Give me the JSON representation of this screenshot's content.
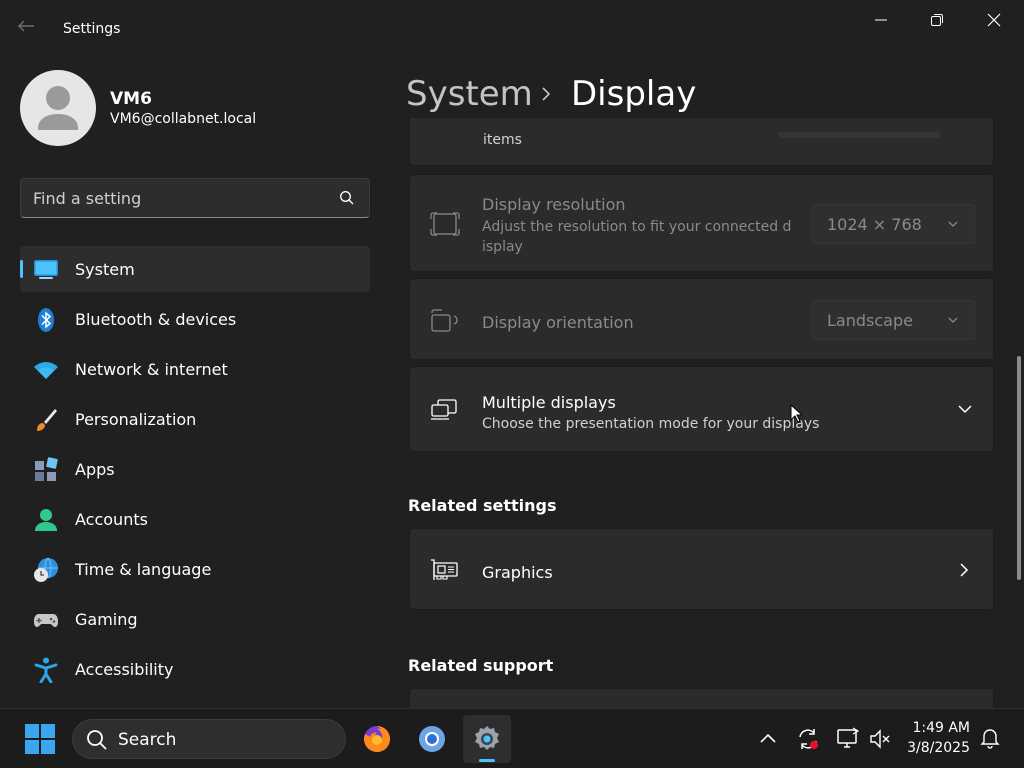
{
  "window": {
    "title": "Settings"
  },
  "profile": {
    "name": "VM6",
    "email": "VM6@collabnet.local"
  },
  "search": {
    "placeholder": "Find a setting"
  },
  "nav": {
    "items": [
      {
        "label": "System",
        "icon": "system-icon",
        "active": true
      },
      {
        "label": "Bluetooth & devices",
        "icon": "bluetooth-icon"
      },
      {
        "label": "Network & internet",
        "icon": "wifi-icon"
      },
      {
        "label": "Personalization",
        "icon": "brush-icon"
      },
      {
        "label": "Apps",
        "icon": "apps-icon"
      },
      {
        "label": "Accounts",
        "icon": "accounts-icon"
      },
      {
        "label": "Time & language",
        "icon": "globe-clock-icon"
      },
      {
        "label": "Gaming",
        "icon": "gamepad-icon"
      },
      {
        "label": "Accessibility",
        "icon": "accessibility-icon"
      }
    ]
  },
  "breadcrumb": {
    "parent": "System",
    "current": "Display"
  },
  "content": {
    "partial_card": {
      "desc_tail": "items"
    },
    "resolution": {
      "title": "Display resolution",
      "desc_line1": "Adjust the resolution to fit your connected d",
      "desc_line2": "isplay",
      "value": "1024 × 768"
    },
    "orientation": {
      "title": "Display orientation",
      "value": "Landscape"
    },
    "multiple_displays": {
      "title": "Multiple displays",
      "desc": "Choose the presentation mode for your displays"
    },
    "related_settings": {
      "heading": "Related settings",
      "graphics": "Graphics"
    },
    "related_support": {
      "heading": "Related support"
    }
  },
  "taskbar": {
    "search_label": "Search",
    "time": "1:49 AM",
    "date": "3/8/2025"
  },
  "colors": {
    "accent": "#4cc2ff",
    "background": "#202020",
    "card": "#2b2b2b"
  }
}
